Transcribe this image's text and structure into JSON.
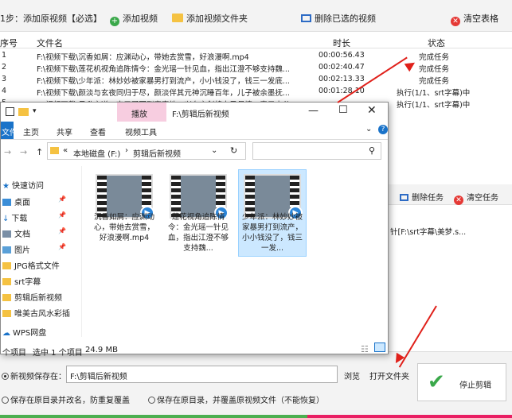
{
  "toolbar": {
    "step_label": "1步：添加原视频【必选】",
    "add_video": "添加视频",
    "add_folder": "添加视频文件夹",
    "delete_selected": "删除已选的视频",
    "clear_table": "清空表格"
  },
  "table": {
    "headers": {
      "index": "序号",
      "filename": "文件名",
      "duration": "时长",
      "status": "状态"
    },
    "rows": [
      {
        "index": "1",
        "filename": "F:\\视频下载\\沉香如屑：应渊动心，带她去赏雪，好浪漫啊.mp4",
        "duration": "00:00:56.43",
        "status": "完成任务"
      },
      {
        "index": "2",
        "filename": "F:\\视频下载\\莲花机视角追陈情令：金光瑶一针见血，指出江澄不够支持魏...",
        "duration": "00:02:40.47",
        "status": "完成任务"
      },
      {
        "index": "3",
        "filename": "F:\\视频下载\\少年派：林妙妙被家暴男打到流产，小小钱没了，钱三一发底...",
        "duration": "00:02:13.33",
        "status": "完成任务"
      },
      {
        "index": "4",
        "filename": "F:\\视频下载\\颜淡与玄夜同归于尽，颜淡伴其元神沉睡百年，儿子被余墨抚...",
        "duration": "00:01:28.10",
        "status": "执行(1/1、srt字幕)中"
      },
      {
        "index": "5",
        "filename": "F:\\视频下载\\日升之道：李三哥回到家宿地，兴东之剑将自己母情，表示本分...",
        "duration": "",
        "status": "执行(1/1、srt字幕)中"
      }
    ]
  },
  "right_panel": {
    "delete_task": "删除任务",
    "clear_task": "清空任务",
    "log_text": "针[F:\\srt字幕\\美梦.s..."
  },
  "explorer": {
    "title": "F:\\剪辑后新视频",
    "tab_play": "播放",
    "tab_file": "文件",
    "tab_home": "主页",
    "tab_share": "共享",
    "tab_view": "查看",
    "tab_video_tools": "视频工具",
    "path_drive": "本地磁盘 (F:)",
    "path_folder": "剪辑后新视频",
    "nav": [
      "快速访问",
      "桌面",
      "下载",
      "文档",
      "图片",
      "JPG格式文件",
      "srt字幕",
      "剪辑后新视频",
      "唯美古风水彩插",
      "WPS网盘"
    ],
    "files": [
      "沉香如屑：应渊动心，带她去赏雪，好浪漫啊.mp4",
      "莲花视角追陈情令：金光瑶一针见血，指出江澄不够支持魏...",
      "少年派：林妙妙被家暴男打到流产，小小钱没了，钱三一发..."
    ],
    "status_items": "个项目",
    "status_selected": "选中 1 个项目",
    "status_size": "24.9 MB"
  },
  "bottom": {
    "save_label": "新视频保存在：",
    "save_path": "F:\\剪辑后新视频",
    "browse": "浏览",
    "open_folder": "打开文件夹",
    "option1": "保存在原目录并改名，防重复覆盖",
    "option2": "保存在原目录，并覆盖原视频文件（不能恢复）",
    "stop": "停止剪辑"
  },
  "colors": {
    "accent_red": "#e0201a",
    "video_tools_tab": "#f7cde0",
    "selected_blue": "#cce8ff"
  }
}
